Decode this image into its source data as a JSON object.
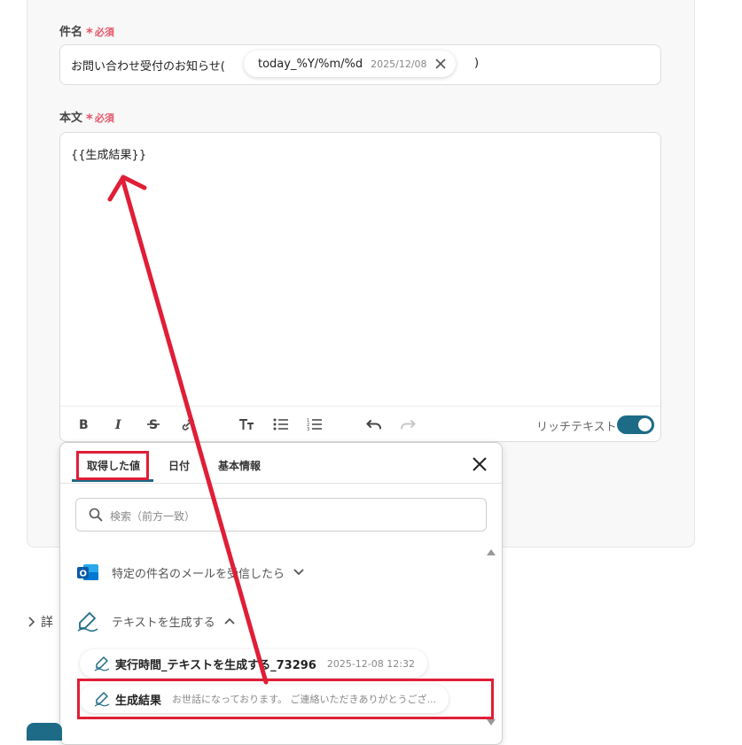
{
  "subject": {
    "label": "件名",
    "required": "必須",
    "prefix": "お問い合わせ受付のお知らせ(",
    "chip_label": "today_%Y/%m/%d",
    "chip_date": "2025/12/08",
    "suffix": ")"
  },
  "body": {
    "label": "本文",
    "required": "必須",
    "content": "{{生成結果}}",
    "rich_text_label": "リッチテキスト",
    "rich_text_enabled": true
  },
  "panel": {
    "tabs": [
      {
        "label": "取得した値",
        "active": true
      },
      {
        "label": "日付",
        "active": false
      },
      {
        "label": "基本情報",
        "active": false
      }
    ],
    "search_placeholder": "検索（前方一致）",
    "groups": [
      {
        "label": "特定の件名のメールを受信したら",
        "icon": "outlook-icon",
        "expanded": false
      },
      {
        "label": "テキストを生成する",
        "icon": "pen-icon",
        "expanded": true
      }
    ],
    "items": [
      {
        "name": "実行時間_テキストを生成する_73296",
        "value": "2025-12-08 12:32"
      },
      {
        "name": "生成結果",
        "value": "お世話になっております。 ご連絡いただきありがとうござ..."
      }
    ]
  },
  "details": {
    "label": "詳"
  },
  "colors": {
    "accent": "#1d6b86",
    "highlight": "#e01e37",
    "required": "#e5566a"
  }
}
